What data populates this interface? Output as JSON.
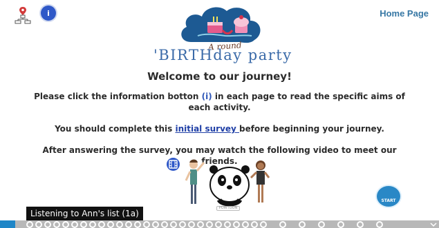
{
  "header": {
    "home_link": "Home Page",
    "info_icon_glyph": "i",
    "sitemap_icon": "sitemap-icon"
  },
  "logo": {
    "script_text": "A round",
    "title_text": "'BIRTHday party"
  },
  "main": {
    "welcome": "Welcome to our journey!",
    "para1": {
      "before": "Please click the information botton ",
      "info_ref": "(i)",
      "after": " in each page to read the specific aims of each activity."
    },
    "para2": {
      "before": "You should complete this ",
      "link": "initial survey ",
      "after": "before beginning your journey."
    },
    "para3": "After answering the survey, you may watch the following video to meet our friends."
  },
  "video": {
    "film_icon": "film-icon",
    "watermark": "POWTOON"
  },
  "start_button": {
    "label": "START"
  },
  "tooltip": {
    "text": "Listening to Ann's list (1a)"
  },
  "colors": {
    "accent": "#2f58c8",
    "home_link": "#3677a4",
    "nav_current": "#1f86c7",
    "nav_bar": "#b8b8b8"
  }
}
